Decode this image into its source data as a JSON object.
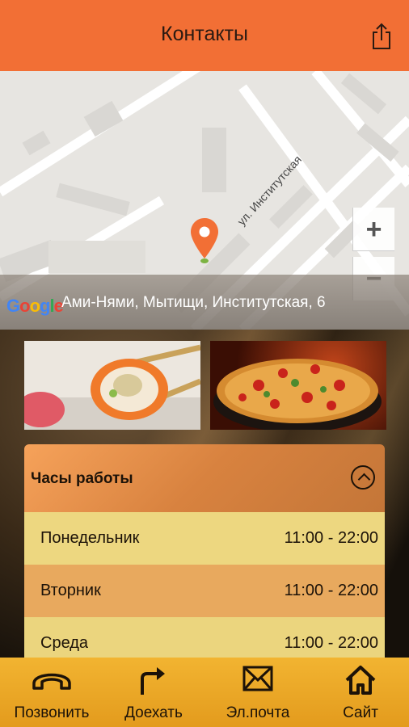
{
  "header": {
    "title": "Контакты",
    "share_icon": "share-icon"
  },
  "map": {
    "street_label": "ул. Институтская",
    "zoom_in": "+",
    "zoom_out": "−",
    "google_logo": "Google",
    "address": "Ами-Нями, Мытищи, Институтская, 6",
    "pin_color": "#f26f35"
  },
  "hours": {
    "title": "Часы работы",
    "rows": [
      {
        "day": "Понедельник",
        "time": "11:00 - 22:00"
      },
      {
        "day": "Вторник",
        "time": "11:00 - 22:00"
      },
      {
        "day": "Среда",
        "time": "11:00 - 22:00"
      }
    ]
  },
  "tabbar": {
    "items": [
      {
        "label": "Позвонить",
        "icon": "phone-icon"
      },
      {
        "label": "Доехать",
        "icon": "route-arrow-icon"
      },
      {
        "label": "Эл.почта",
        "icon": "envelope-icon"
      },
      {
        "label": "Сайт",
        "icon": "home-icon"
      }
    ]
  },
  "colors": {
    "accent": "#f26f35",
    "tabbar": "#f2b431"
  }
}
